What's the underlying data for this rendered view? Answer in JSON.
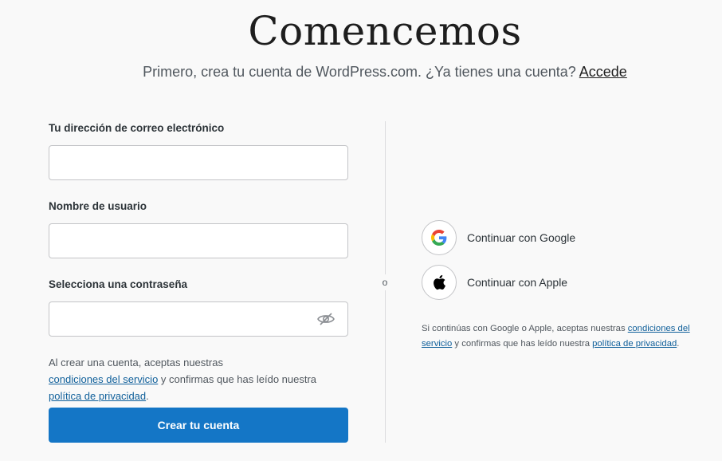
{
  "header": {
    "title": "Comencemos",
    "subtitle": "Primero, crea tu cuenta de WordPress.com. ¿Ya tienes una cuenta?",
    "login_link": "Accede"
  },
  "form": {
    "email_label": "Tu dirección de correo electrónico",
    "email_value": "",
    "username_label": "Nombre de usuario",
    "username_value": "",
    "password_label": "Selecciona una contraseña",
    "password_value": "",
    "password_toggle_icon": "eye-slash-icon",
    "terms_prefix": "Al crear una cuenta, aceptas nuestras",
    "terms_link": "condiciones del servicio",
    "terms_middle": " y confirmas que has leído nuestra",
    "privacy_link": "política de privacidad",
    "terms_suffix": ".",
    "submit_label": "Crear tu cuenta"
  },
  "divider": {
    "label": "o"
  },
  "social": {
    "google_label": "Continuar con Google",
    "google_icon": "google-icon",
    "apple_label": "Continuar con Apple",
    "apple_icon": "apple-icon",
    "terms_prefix": "Si continúas con Google o Apple, aceptas nuestras ",
    "terms_link": "condiciones del servicio",
    "terms_middle": " y confirmas que has leído nuestra ",
    "privacy_link": "política de privacidad",
    "terms_suffix": "."
  },
  "colors": {
    "background": "#f9f9f9",
    "primary_button": "#1476c6",
    "link": "#0f5f9a",
    "input_border": "#c3c4c7"
  }
}
